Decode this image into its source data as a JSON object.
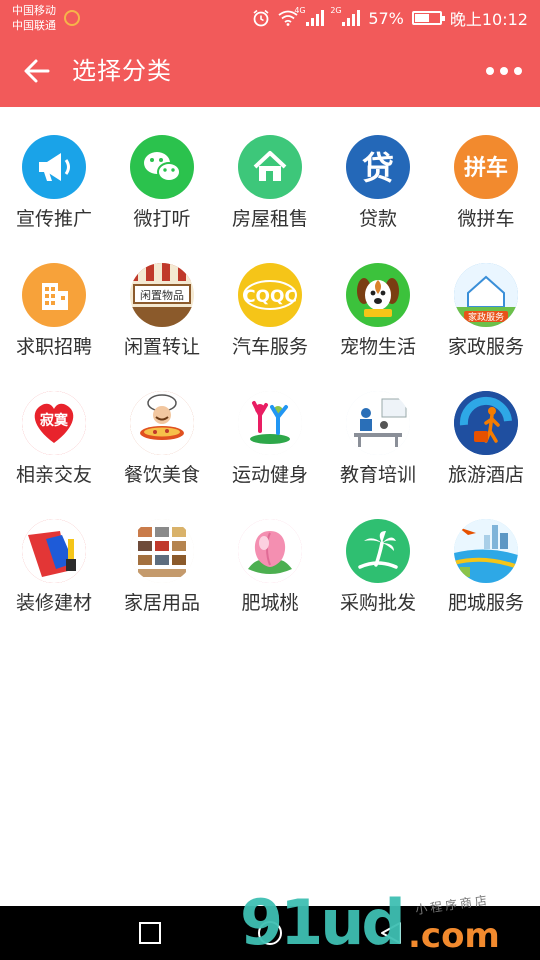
{
  "status_bar": {
    "carrier_1": "中国移动",
    "carrier_2": "中国联通",
    "network_1": "4G",
    "network_2": "2G",
    "battery": "57%",
    "battery_level": 0.57,
    "time": "晚上10:12"
  },
  "header": {
    "title": "选择分类",
    "back_icon": "arrow-left-icon",
    "more_icon": "more-dots-icon"
  },
  "colors": {
    "header_bg": "#f25a5a",
    "label_text": "#333333"
  },
  "categories": [
    {
      "label": "宣传推广",
      "icon": "megaphone-icon",
      "color": "#1aa3e8"
    },
    {
      "label": "微打听",
      "icon": "wechat-icon",
      "color": "#2bc24d"
    },
    {
      "label": "房屋租售",
      "icon": "house-icon",
      "color": "#3dc77a"
    },
    {
      "label": "贷款",
      "icon": "loan-icon",
      "color": "#2468b8",
      "glyph": "贷"
    },
    {
      "label": "微拼车",
      "icon": "carpool-icon",
      "color": "#f28a2e",
      "glyph": "拼车"
    },
    {
      "label": "求职招聘",
      "icon": "building-icon",
      "color": "#f7a23a"
    },
    {
      "label": "闲置转让",
      "icon": "market-stall-icon",
      "color": "#f4e9d2",
      "glyph": "闲置物品"
    },
    {
      "label": "汽车服务",
      "icon": "cqqc-logo-icon",
      "color": "#f5c518",
      "glyph": "CQQC"
    },
    {
      "label": "宠物生活",
      "icon": "dog-icon",
      "color": "#3cc23c"
    },
    {
      "label": "家政服务",
      "icon": "housekeeping-icon",
      "color": "#5aa8e0",
      "glyph": "家政服务"
    },
    {
      "label": "相亲交友",
      "icon": "heart-icon",
      "color": "#e8232c",
      "glyph": "寂寞"
    },
    {
      "label": "餐饮美食",
      "icon": "chef-icon",
      "color": "#c9542a"
    },
    {
      "label": "运动健身",
      "icon": "fitness-icon",
      "color": "#e8e8e8"
    },
    {
      "label": "教育培训",
      "icon": "classroom-icon",
      "color": "#d8e6f2"
    },
    {
      "label": "旅游酒店",
      "icon": "travel-icon",
      "color": "#1f4fa0"
    },
    {
      "label": "装修建材",
      "icon": "paint-icon",
      "color": "#e33636"
    },
    {
      "label": "家居用品",
      "icon": "furniture-icon",
      "color": "#eee4d8"
    },
    {
      "label": "肥城桃",
      "icon": "peach-icon",
      "color": "#f48fb1"
    },
    {
      "label": "采购批发",
      "icon": "palm-island-icon",
      "color": "#2fbf71"
    },
    {
      "label": "肥城服务",
      "icon": "city-icon",
      "color": "#9fd4f0"
    }
  ],
  "nav_bar": {
    "recent_icon": "square-recent-icon",
    "home_icon": "circle-home-icon",
    "back_icon": "triangle-back-icon"
  },
  "watermark": {
    "main": "91ud",
    "suffix": ".com",
    "tagline": "小程序商店"
  }
}
